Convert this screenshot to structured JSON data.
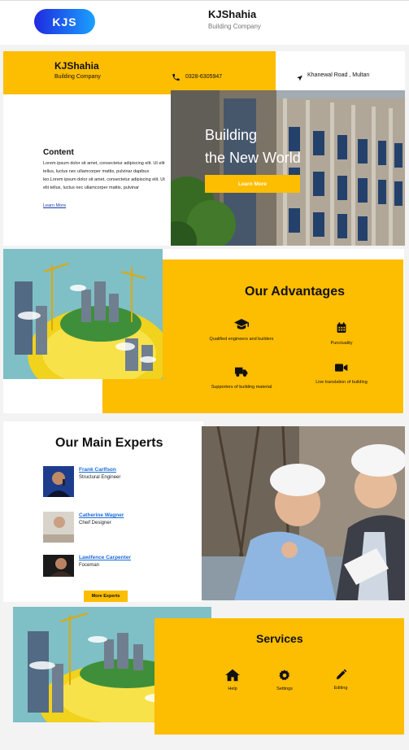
{
  "topbar": {
    "logo": "KJS",
    "title": "KJShahia",
    "subtitle": "Building Company"
  },
  "header": {
    "title": "KJShahia",
    "subtitle": "Building Company",
    "phone": "0328-6305947",
    "location": "Khanewal Road , Multan",
    "phone_icon": "phone-icon",
    "location_icon": "location-arrow-icon"
  },
  "hero": {
    "content_title": "Content",
    "content_body": "Lorem ipsum dolor sit amet, consectetur adipiscing elit. Ut elit tellus, luctus nec ullamcorper mattis, pulvinar dapibus leo.Lorem ipsum dolor sit amet, consectetur adipiscing elit. Ut elit tellus, luctus nec ullamcorper mattis, pulvinar",
    "content_link": "Learn More",
    "heading_line1": "Building",
    "heading_line2": "the New World",
    "button": "Learn More"
  },
  "advantages": {
    "title": "Our Advantages",
    "items": [
      {
        "label": "Qualified engineers and builders",
        "icon": "graduation-cap-icon"
      },
      {
        "label": "Punctuality",
        "icon": "calendar-icon"
      },
      {
        "label": "Supporters of building material",
        "icon": "truck-icon"
      },
      {
        "label": "Live translation of building",
        "icon": "video-camera-icon"
      }
    ]
  },
  "experts": {
    "title": "Our Main Experts",
    "people": [
      {
        "name": "Frank Carlfson",
        "role": "Structural Engineer"
      },
      {
        "name": "Catherine Wagner",
        "role": "Cheif Designer"
      },
      {
        "name": "Lawifence Carpenter",
        "role": "Foceman"
      }
    ],
    "button": "More Experts"
  },
  "services": {
    "title": "Services",
    "items": [
      {
        "label": "Help",
        "icon": "home-icon"
      },
      {
        "label": "Settings",
        "icon": "gear-icon"
      },
      {
        "label": "Editing",
        "icon": "pencil-icon"
      }
    ]
  },
  "colors": {
    "accent": "#fdbd00",
    "link": "#1a6bd8",
    "logo_gradient_start": "#1f2ae0",
    "logo_gradient_end": "#1aa1ff"
  }
}
